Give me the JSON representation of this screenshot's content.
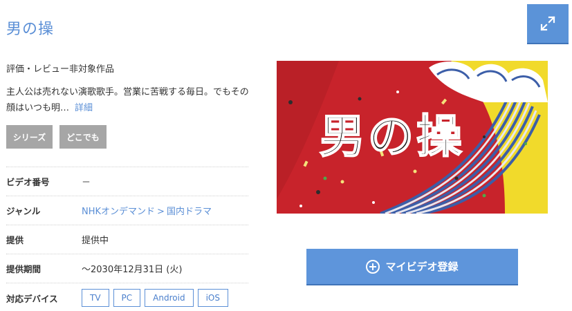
{
  "title": "男の操",
  "expand_icon": "expand-arrows-icon",
  "rating_note": "評価・レビュー非対象作品",
  "synopsis": {
    "text": "主人公は売れない演歌歌手。営業に苦戦する毎日。でもその顔はいつも明…",
    "more_label": "詳細"
  },
  "tags": {
    "series": "シリーズ",
    "anywhere": "どこでも"
  },
  "info": {
    "video_number": {
      "label": "ビデオ番号",
      "value": "－"
    },
    "genre": {
      "label": "ジャンル",
      "link1": "NHKオンデマンド",
      "separator": ">",
      "link2": "国内ドラマ"
    },
    "provided": {
      "label": "提供",
      "value": "提供中"
    },
    "period": {
      "label": "提供期間",
      "value": "～2030年12月31日 (火)"
    },
    "devices": {
      "label": "対応デバイス",
      "items": [
        "TV",
        "PC",
        "Android",
        "iOS"
      ]
    }
  },
  "thumbnail": {
    "title_text": "男の操",
    "colors": {
      "red": "#c8232b",
      "yellow": "#f1da2b",
      "wave_blue": "#3c5ea8"
    }
  },
  "register_button": {
    "label": "マイビデオ登録",
    "icon": "plus-circle-icon"
  },
  "colors": {
    "accent": "#5b8fd6",
    "tag_bg": "#a6a6a6",
    "button": "#5e95db"
  }
}
